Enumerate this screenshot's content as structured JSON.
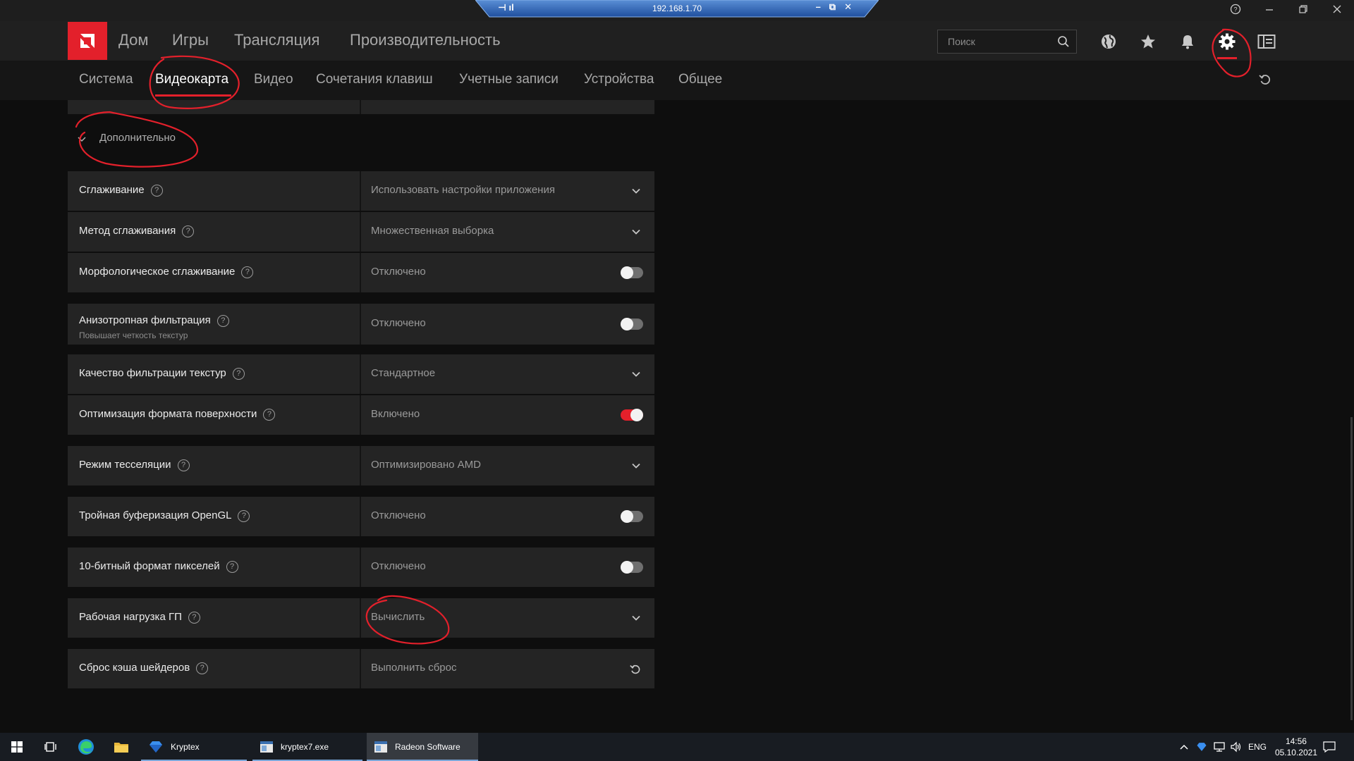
{
  "remote": {
    "ip": "192.168.1.70"
  },
  "nav": {
    "items": [
      "Дом",
      "Игры",
      "Трансляция",
      "Производительность"
    ],
    "search_placeholder": "Поиск"
  },
  "tabs": [
    "Система",
    "Видеокарта",
    "Видео",
    "Сочетания клавиш",
    "Учетные записи",
    "Устройства",
    "Общее"
  ],
  "active_tab": "Видеокарта",
  "advanced_label": "Дополнительно",
  "settings": [
    {
      "label": "Сглаживание",
      "value": "Использовать настройки приложения",
      "control": "dropdown"
    },
    {
      "label": "Метод сглаживания",
      "value": "Множественная выборка",
      "control": "dropdown"
    },
    {
      "label": "Морфологическое сглаживание",
      "value": "Отключено",
      "control": "toggle",
      "on": false
    },
    {
      "label": "Анизотропная фильтрация",
      "sublabel": "Повышает четкость текстур",
      "value": "Отключено",
      "control": "toggle",
      "on": false
    },
    {
      "label": "Качество фильтрации текстур",
      "value": "Стандартное",
      "control": "dropdown"
    },
    {
      "label": "Оптимизация формата поверхности",
      "value": "Включено",
      "control": "toggle",
      "on": true
    },
    {
      "label": "Режим тесселяции",
      "value": "Оптимизировано AMD",
      "control": "dropdown"
    },
    {
      "label": "Тройная буферизация OpenGL",
      "value": "Отключено",
      "control": "toggle",
      "on": false
    },
    {
      "label": "10-битный формат пикселей",
      "value": "Отключено",
      "control": "toggle",
      "on": false
    },
    {
      "label": "Рабочая нагрузка ГП",
      "value": "Вычислить",
      "control": "dropdown"
    },
    {
      "label": "Сброс кэша шейдеров",
      "value": "Выполнить сброс",
      "control": "reset"
    }
  ],
  "taskbar": {
    "apps": [
      {
        "label": "Kryptex",
        "icon": "kryptex-icon"
      },
      {
        "label": "kryptex7.exe",
        "icon": "exe-window-icon"
      },
      {
        "label": "Radeon Software",
        "icon": "radeon-window-icon"
      }
    ],
    "language": "ENG",
    "time": "14:56",
    "date": "05.10.2021"
  },
  "colors": {
    "accent": "#e3202b",
    "background": "#0e0e0e",
    "row": "#242424"
  }
}
